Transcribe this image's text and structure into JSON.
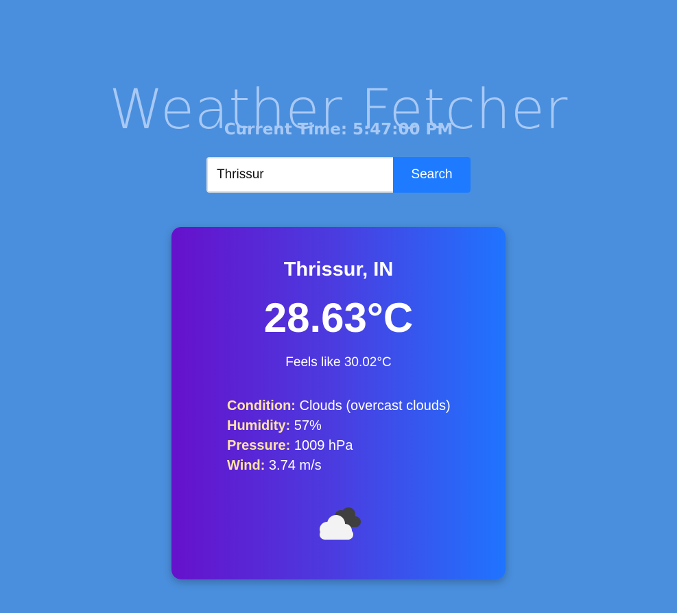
{
  "app": {
    "title": "Weather Fetcher",
    "current_time": "Current Time: 5:47:00 PM"
  },
  "search": {
    "value": "Thrissur",
    "button_label": "Search"
  },
  "weather": {
    "location": "Thrissur, IN",
    "temperature": "28.63°C",
    "feels_like": "Feels like 30.02°C",
    "details": [
      {
        "label": "Condition:",
        "value": "Clouds (overcast clouds)"
      },
      {
        "label": "Humidity:",
        "value": "57%"
      },
      {
        "label": "Pressure:",
        "value": "1009 hPa"
      },
      {
        "label": "Wind:",
        "value": "3.74 m/s"
      }
    ],
    "icon": "overcast-clouds-icon"
  },
  "colors": {
    "background": "#4a8fdd",
    "title_text": "#a9c9f5",
    "search_button": "#1e7bff",
    "card_gradient_start": "#6611cc",
    "card_gradient_end": "#1f74ff",
    "detail_label": "#ffe3a8"
  }
}
